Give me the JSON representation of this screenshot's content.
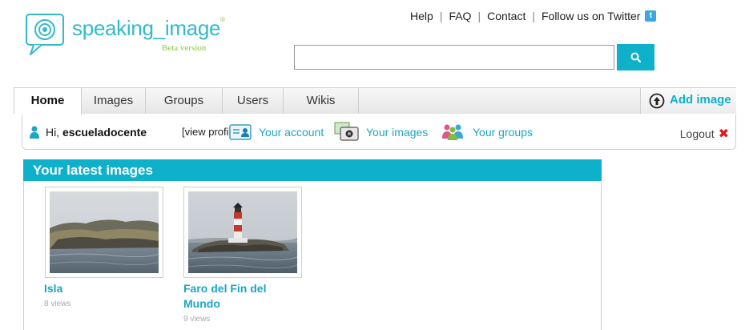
{
  "logo": {
    "brand": "speaking_image",
    "registered": "®",
    "tagline": "Beta version"
  },
  "toplinks": {
    "help": "Help",
    "faq": "FAQ",
    "contact": "Contact",
    "twitter": "Follow us on Twitter",
    "separator": "|"
  },
  "search": {
    "value": "",
    "placeholder": ""
  },
  "nav": {
    "tabs": [
      {
        "label": "Home",
        "active": true
      },
      {
        "label": "Images"
      },
      {
        "label": "Groups"
      },
      {
        "label": "Users"
      },
      {
        "label": "Wikis"
      }
    ],
    "add_image": "Add image"
  },
  "userbar": {
    "greeting": "Hi,",
    "username": "escueladocente",
    "view_profile": "[view profile]",
    "your_account": "Your account",
    "your_images": "Your images",
    "your_groups": "Your groups",
    "logout": "Logout"
  },
  "latest": {
    "title": "Your latest images",
    "images": [
      {
        "title": "Isla",
        "views": "8 views"
      },
      {
        "title": "Faro del Fin del Mundo",
        "views": "9 views"
      }
    ]
  },
  "colors": {
    "accent": "#0fb0c9",
    "link": "#1aa6c4",
    "logout_x": "#e01818",
    "brand_green": "#8cc63f"
  }
}
